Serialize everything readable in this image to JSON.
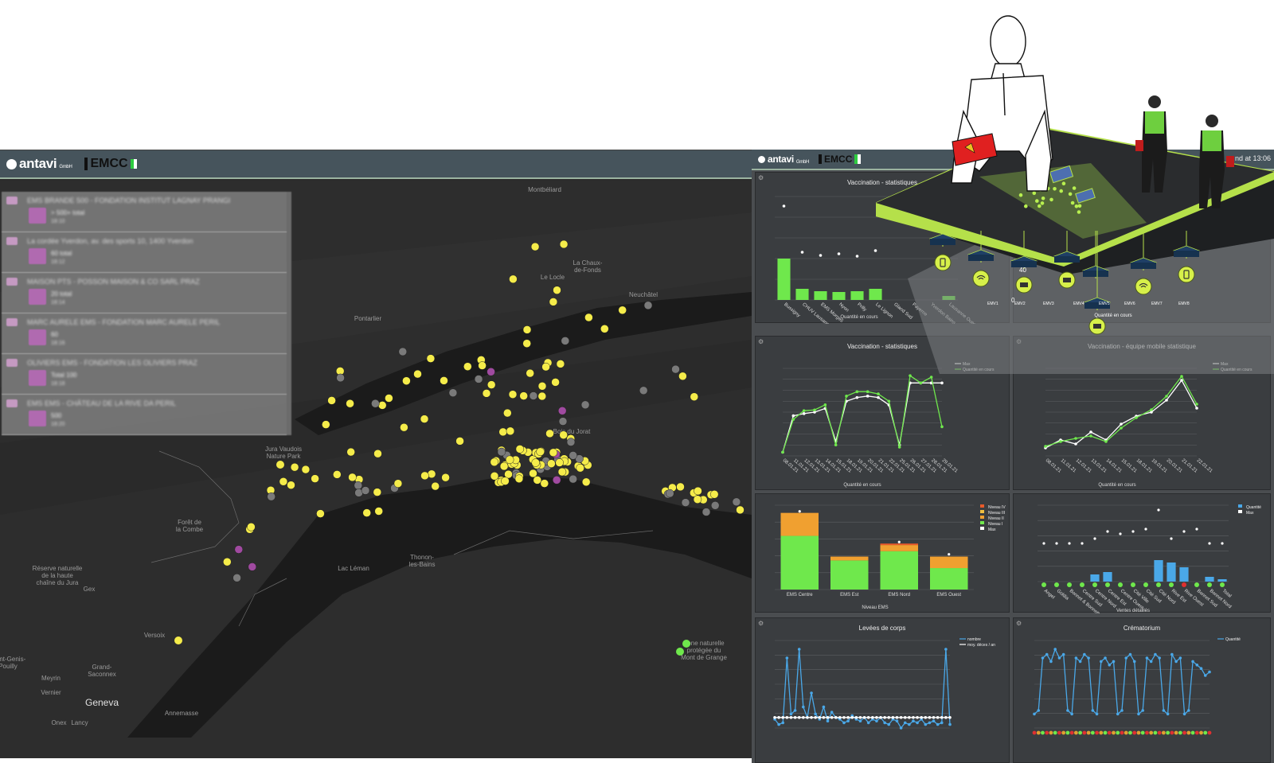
{
  "map_window": {
    "brand": {
      "antavi": "antavi",
      "antavi_suffix": "GmbH",
      "emcc": "EMCC"
    },
    "incidents": [
      {
        "title": "EMS BRANDE 500 - FONDATION INSTITUT LAGNAY PRANGI",
        "sub": "> 500+ total",
        "time": "18:10"
      },
      {
        "title": "La cordée Yverdon, av. des sports 10, 1400 Yverdon",
        "sub": "60 total",
        "time": "18:12"
      },
      {
        "title": "MAISON PTS - POSSON MAISON & CO SARL PRAZ",
        "sub": "20 total",
        "time": "18:14"
      },
      {
        "title": "MARC AURELE EMS - FONDATION MARC AURELE PERIL",
        "sub": "60",
        "time": "18:16"
      },
      {
        "title": "OLIVIERS EMS - FONDATION LES OLIVIERS PRAZ",
        "sub": "Total 100",
        "time": "18:18"
      },
      {
        "title": "EMS EMS - CHÂTEAU DE LA RIVE DA PERIL",
        "sub": "500",
        "time": "18:20"
      }
    ],
    "place_labels": {
      "geneva": "Geneva",
      "versoix": "Versoix",
      "annemasse": "Annemasse",
      "thonon": "Thonon-\nles-Bains",
      "saint_genis": "Saint-Genis-\nPouilly",
      "grand_saconnex": "Grand-\nSaconnex",
      "meyrin": "Meyrin",
      "vernier": "Vernier",
      "onex": "Onex",
      "lancy": "Lancy",
      "gex": "Gex",
      "pontarlier": "Pontarlier",
      "le_locle": "Le Locle",
      "chaux_de_fonds": "La Chaux-\nde-Fonds",
      "neuchatel": "Neuchâtel",
      "montbeliard": "Montbéliard",
      "foret_combe": "Forêt de\nla Combe",
      "reserve_jura": "Réserve naturelle\nde la haute\nchaîne du Jura",
      "jura_vaudois": "Jura Vaudois\nNature Park",
      "bois_du_jorat": "Bois du Jorat",
      "lac_leman": "Lac Léman",
      "zone_naturelle": "Zone naturelle\nprotégée du\nMont de Grange"
    }
  },
  "dashboard": {
    "clock": "nd at 13:06",
    "panels": {
      "vacc_bar": {
        "title": "Vaccination - statistiques",
        "xlabel": "Quantité en cours"
      },
      "vacc_line": {
        "title": "Vaccination - statistiques",
        "xlabel": "Quantité en cours"
      },
      "mobile_line": {
        "title": "Vaccination - équipe mobile statistique",
        "xlabel": "Quantité en cours"
      },
      "ems_stack": {
        "xlabel": "Niveau EMS"
      },
      "dots_chart": {
        "xlabel": "Ventes détaillés"
      },
      "levees": {
        "title": "Levées de corps"
      },
      "crematorium": {
        "title": "Crématorium"
      }
    },
    "overlay_labels": [
      "EMV1",
      "EMV2",
      "EMV3",
      "EMV4",
      "EMV5",
      "EMV6",
      "EMV7",
      "EMV8"
    ],
    "overlay_numbers": [
      "40",
      "0"
    ],
    "overlay_xlabel": "Quantité en cours"
  },
  "chart_data": [
    {
      "type": "bar",
      "title": "Vaccination - statistiques",
      "xlabel": "Quantité en cours",
      "categories": [
        "Bussigny",
        "CHUV Lausanne",
        "EMS Morges",
        "Nyon",
        "Prilly",
        "Le Lignon",
        "Gland Sud",
        "Payerne",
        "Yverdon Bains",
        "Lausanne Ouest"
      ],
      "series": [
        {
          "name": "Quantité en cours",
          "values": [
            52,
            14,
            11,
            10,
            11,
            14,
            0,
            0,
            0,
            5
          ]
        },
        {
          "name": "Max",
          "values": [
            118,
            60,
            56,
            58,
            55,
            62,
            0,
            0,
            0,
            0
          ]
        }
      ],
      "colors": [
        "#6fe84c",
        "#ffffff"
      ]
    },
    {
      "type": "line",
      "title": "Vaccination - statistiques",
      "xlabel": "Quantité en cours",
      "x": [
        "08.01.21",
        "11.01.21",
        "12.01.21",
        "13.01.21",
        "14.01.21",
        "15.01.21",
        "18.01.21",
        "19.01.21",
        "20.01.21",
        "21.01.21",
        "22.01.21",
        "25.01.21",
        "26.01.21",
        "27.01.21",
        "28.01.21",
        "29.01.21"
      ],
      "series": [
        {
          "name": "Max",
          "values": [
            5,
            55,
            58,
            60,
            65,
            20,
            75,
            80,
            82,
            80,
            70,
            15,
            100,
            100,
            100,
            100
          ]
        },
        {
          "name": "Quantité en cours",
          "values": [
            5,
            50,
            62,
            63,
            70,
            15,
            82,
            88,
            88,
            85,
            75,
            12,
            110,
            100,
            108,
            40
          ]
        }
      ],
      "colors": [
        "#ffffff",
        "#6fe84c"
      ]
    },
    {
      "type": "line",
      "title": "Vaccination - équipe mobile statistique",
      "xlabel": "Quantité en cours",
      "x": [
        "08.01.21",
        "11.01.21",
        "12.01.21",
        "13.01.21",
        "14.01.21",
        "15.01.21",
        "18.01.21",
        "19.01.21",
        "20.01.21",
        "21.01.21",
        "22.01.21"
      ],
      "series": [
        {
          "name": "Max",
          "values": [
            10,
            20,
            15,
            30,
            20,
            40,
            50,
            55,
            70,
            95,
            60
          ]
        },
        {
          "name": "Quantité en cours",
          "values": [
            12,
            18,
            22,
            25,
            18,
            35,
            48,
            58,
            75,
            100,
            65
          ]
        }
      ],
      "colors": [
        "#ffffff",
        "#6fe84c"
      ]
    },
    {
      "type": "bar",
      "xlabel": "Niveau EMS",
      "categories": [
        "EMS Centre",
        "EMS Est",
        "EMS Nord",
        "EMS Ouest"
      ],
      "series": [
        {
          "name": "Niveau IV",
          "values": [
            0,
            0,
            2,
            0
          ]
        },
        {
          "name": "Niveau III",
          "values": [
            0,
            0,
            0,
            0
          ]
        },
        {
          "name": "Niveau II",
          "values": [
            30,
            5,
            8,
            15
          ]
        },
        {
          "name": "Niveau I",
          "values": [
            70,
            38,
            50,
            28
          ]
        },
        {
          "name": "Max",
          "values": [
            102,
            0,
            62,
            46
          ]
        }
      ],
      "colors": [
        "#e85a2a",
        "#f0c040",
        "#f0a030",
        "#6fe84c",
        "#ffffff"
      ],
      "legend": "top-right"
    },
    {
      "type": "bar",
      "xlabel": "Ventes détaillés",
      "categories": [
        "Angel",
        "Goldia",
        "Bonnet & Bonnette",
        "Centre Sud",
        "Centre Nord",
        "Centre Est",
        "Centre Ouest",
        "Cité Ville",
        "Cité Sud",
        "Cité Nord",
        "Rive Est",
        "Rive Ouest",
        "Bonnet Sud",
        "Bonnet Nord",
        "Total"
      ],
      "series": [
        {
          "name": "Quantité",
          "values": [
            0,
            0,
            0,
            0,
            3,
            4,
            0,
            0,
            0,
            9,
            8,
            6,
            0,
            2,
            1
          ]
        },
        {
          "name": "Max",
          "values": [
            16,
            16,
            16,
            16,
            18,
            21,
            20,
            21,
            22,
            30,
            18,
            21,
            22,
            16,
            16
          ]
        }
      ],
      "colors": [
        "#4aa8e8",
        "#ffffff"
      ],
      "legend": "top-right"
    },
    {
      "type": "line",
      "title": "Levées de corps",
      "series": [
        {
          "name": "nombre",
          "values": [
            5,
            2,
            3,
            40,
            8,
            10,
            45,
            12,
            6,
            20,
            8,
            5,
            12,
            4,
            9,
            6,
            5,
            3,
            4,
            7,
            5,
            4,
            6,
            3,
            5,
            4,
            6,
            3,
            2,
            5,
            4,
            0,
            3,
            2,
            4,
            3,
            5,
            2,
            3,
            4,
            2,
            3,
            45,
            2
          ]
        },
        {
          "name": "moy. déces / an",
          "values": [
            6,
            6,
            6,
            6,
            6,
            6,
            6,
            6,
            6,
            6,
            6,
            6,
            6,
            6,
            6,
            6,
            6,
            6,
            6,
            6,
            6,
            6,
            6,
            6,
            6,
            6,
            6,
            6,
            6,
            6,
            6,
            6,
            6,
            6,
            6,
            6,
            6,
            6,
            6,
            6,
            6,
            6,
            6,
            6
          ]
        }
      ],
      "colors": [
        "#4aa8e8",
        "#ffffff"
      ],
      "legend": "top-right"
    },
    {
      "type": "line",
      "title": "Crématorium",
      "series": [
        {
          "name": "Quantité",
          "values": [
            8,
            10,
            40,
            42,
            38,
            45,
            40,
            42,
            10,
            8,
            40,
            38,
            42,
            40,
            10,
            8,
            38,
            40,
            36,
            38,
            8,
            10,
            40,
            42,
            38,
            8,
            10,
            40,
            38,
            42,
            40,
            10,
            8,
            42,
            38,
            40,
            8,
            10,
            38,
            36,
            34,
            30,
            32
          ]
        }
      ],
      "colors": [
        "#4aa8e8"
      ],
      "legend": "top-right"
    }
  ]
}
